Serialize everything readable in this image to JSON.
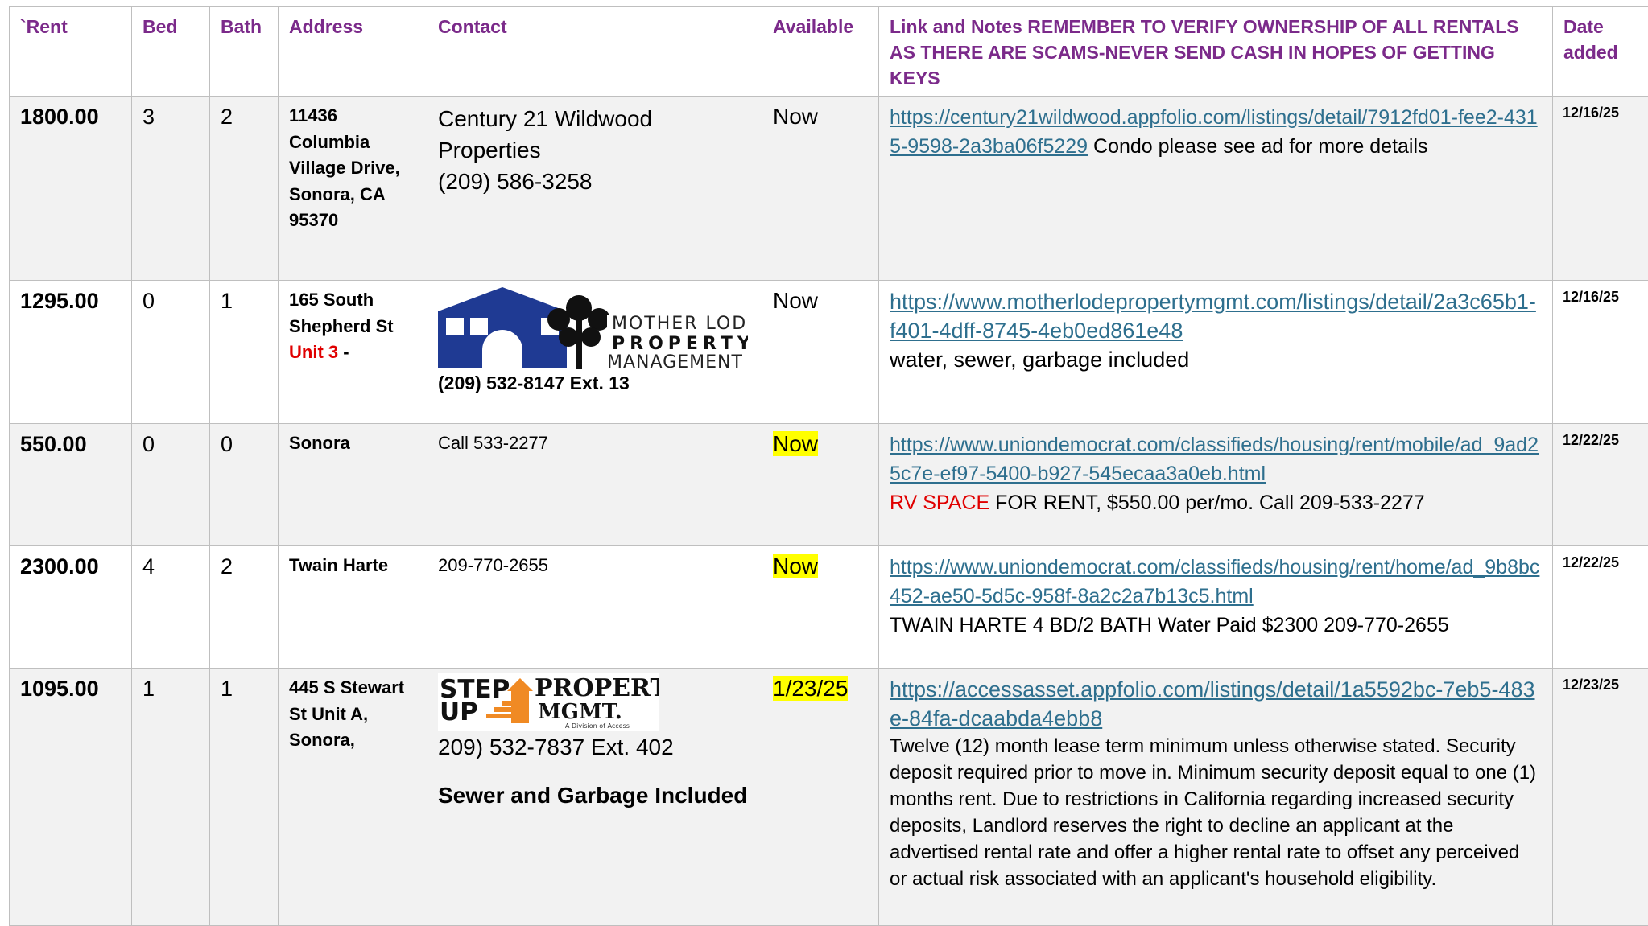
{
  "headers": {
    "rent": "`Rent",
    "bed": "Bed",
    "bath": "Bath",
    "address": "Address",
    "contact": "Contact",
    "available": "Available",
    "notes": "Link and Notes REMEMBER TO VERIFY OWNERSHIP OF ALL RENTALS AS THERE ARE SCAMS-NEVER SEND CASH IN HOPES OF GETTING KEYS",
    "date": "Date added"
  },
  "rows": [
    {
      "rent": "1800.00",
      "bed": "3",
      "bath": "2",
      "address": "11436 Columbia Village Drive, Sonora, CA 95370",
      "contact_line1": "Century 21 Wildwood Properties",
      "contact_line2": "(209) 586-3258",
      "available": "Now",
      "link": "https://century21wildwood.appfolio.com/listings/detail/7912fd01-fee2-4315-9598-2a3ba06f5229",
      "note": "  Condo please see ad for more details",
      "date": "12/16/25"
    },
    {
      "rent": "1295.00",
      "bed": "0",
      "bath": "1",
      "address": "165 South Shepherd St",
      "address_unit": "Unit 3",
      "address_suffix": " -",
      "contact_logo": {
        "line1": "MOTHER LODE",
        "line2": "PROPERTY",
        "line3": "MANAGEMENT"
      },
      "contact_phone": "(209) 532-8147 Ext. 13",
      "available": "Now",
      "link": "https://www.motherlodepropertymgmt.com/listings/detail/2a3c65b1-f401-4dff-8745-4eb0ed861e48",
      "note": "water, sewer, garbage included",
      "date": "12/16/25"
    },
    {
      "rent": "550.00",
      "bed": "0",
      "bath": "0",
      "address": "Sonora",
      "contact": "Call 533-2277",
      "available": "Now",
      "link": "https://www.uniondemocrat.com/classifieds/housing/rent/mobile/ad_9ad25c7e-ef97-5400-b927-545ecaa3a0eb.html",
      "note_red": "RV SPACE",
      "note": " FOR RENT, $550.00 per/mo. Call 209-533-2277",
      "date": "12/22/25"
    },
    {
      "rent": "2300.00",
      "bed": "4",
      "bath": "2",
      "address": "Twain Harte",
      "contact": "209-770-2655",
      "available": "Now",
      "link": "https://www.uniondemocrat.com/classifieds/housing/rent/home/ad_9b8bc452-ae50-5d5c-958f-8a2c2a7b13c5.html",
      "note": "TWAIN HARTE 4 BD/2 BATH Water Paid $2300 209-770-2655",
      "date": "12/22/25"
    },
    {
      "rent": "1095.00",
      "bed": "1",
      "bath": "1",
      "address": "445 S Stewart St Unit A, Sonora,",
      "contact_logo": {
        "line1": "STEP",
        "line2": "UP",
        "line3": "PROPERTY",
        "line4": "MGMT.",
        "line5": "A Division of Access"
      },
      "contact_phone": "209) 532-7837 Ext. 402",
      "contact_extra": "Sewer and Garbage Included",
      "available": "1/23/25",
      "link": "https://accessasset.appfolio.com/listings/detail/1a5592bc-7eb5-483e-84fa-dcaabda4ebb8",
      "note": "Twelve (12) month lease term minimum unless otherwise stated. Security deposit required prior to move in. Minimum security deposit equal to one (1) months rent. Due to restrictions in California regarding increased security deposits, Landlord reserves the right to decline an applicant at the advertised rental rate and offer a higher rental rate to offset any perceived or actual risk associated with an applicant's household eligibility.",
      "date": "12/23/25"
    }
  ],
  "colors": {
    "header_text": "#7b2a8a",
    "link": "#2e6f8e",
    "highlight": "#ffff00",
    "alert_red": "#e00000",
    "mother_lode_blue": "#1f3a93",
    "step_up_orange": "#f08a24"
  }
}
